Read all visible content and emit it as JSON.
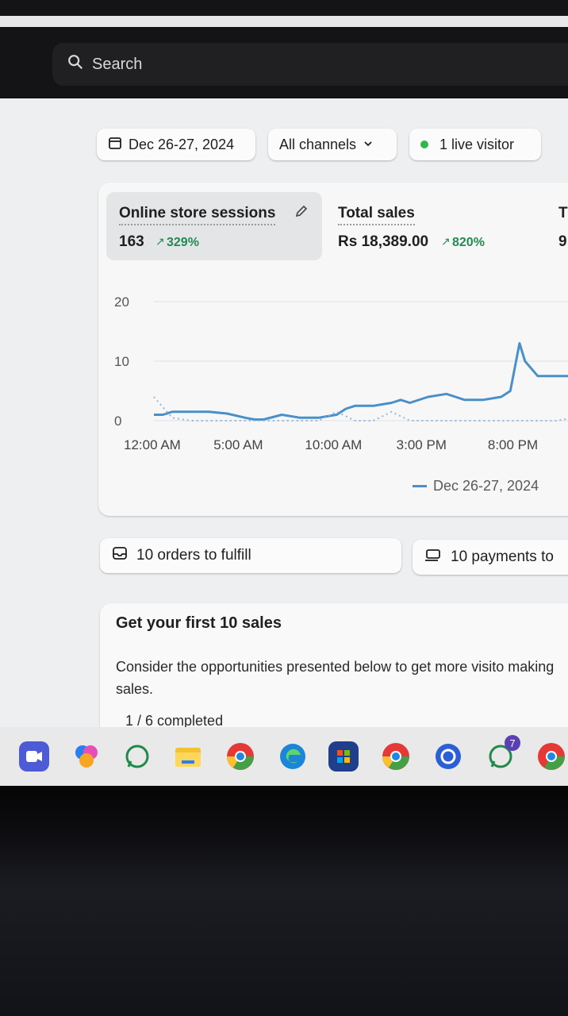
{
  "search": {
    "label": "Search"
  },
  "filters": {
    "date_range": "Dec 26-27, 2024",
    "channels": "All channels",
    "live_visitors": "1 live visitor"
  },
  "metrics": [
    {
      "label": "Online store sessions",
      "value": "163",
      "change": "329%"
    },
    {
      "label": "Total sales",
      "value": "Rs 18,389.00",
      "change": "820%"
    }
  ],
  "metric_partial": {
    "label": "T",
    "value": "9"
  },
  "chart_data": {
    "type": "line",
    "x_ticks": [
      "12:00 AM",
      "5:00 AM",
      "10:00 AM",
      "3:00 PM",
      "8:00 PM"
    ],
    "y_ticks": [
      "20",
      "10",
      "0"
    ],
    "ylim": [
      0,
      20
    ],
    "series": [
      {
        "name": "Dec 26-27, 2024",
        "x": [
          0,
          0.5,
          1,
          2,
          3,
          4,
          5,
          5.5,
          6,
          7,
          8,
          9,
          10,
          10.5,
          11,
          12,
          13,
          13.5,
          14,
          15,
          16,
          16.5,
          17,
          17.5,
          18,
          19,
          19.5,
          20,
          20.3,
          21,
          22,
          23
        ],
        "values": [
          1,
          1,
          1.5,
          1.5,
          1.5,
          1.2,
          0.5,
          0.2,
          0.2,
          1,
          0.5,
          0.5,
          1,
          2,
          2.5,
          2.5,
          3,
          3.5,
          3,
          4,
          4.5,
          4,
          3.5,
          3.5,
          3.5,
          4,
          5,
          13,
          10,
          7.5,
          7.5,
          7.5
        ]
      },
      {
        "name": "comparison",
        "style": "dotted",
        "x": [
          0,
          1,
          2,
          3,
          4,
          5,
          6,
          7,
          8,
          9,
          10,
          11,
          12,
          13,
          14,
          15,
          16,
          17,
          18,
          19,
          20,
          21,
          22,
          23
        ],
        "values": [
          4,
          0.5,
          0,
          0,
          0,
          0,
          0,
          0,
          0,
          0,
          1.5,
          0,
          0,
          1.5,
          0,
          0,
          0,
          0,
          0,
          0,
          0,
          0,
          0,
          0.5
        ]
      }
    ],
    "legend": [
      "Dec 26-27, 2024"
    ],
    "colors": {
      "primary": "#4a90c8",
      "comparison": "#8fb7d9"
    }
  },
  "tasks": {
    "orders": "10 orders to fulfill",
    "payments": "10 payments to"
  },
  "onboarding": {
    "title": "Get your first 10 sales",
    "description": "Consider the opportunities presented below to get more visito making sales.",
    "progress": "1 / 6 completed"
  },
  "taskbar": {
    "icons": [
      "teams-icon",
      "copilot-icon",
      "whatsapp-icon",
      "file-explorer-icon",
      "chrome-icon",
      "edge-icon",
      "microsoft-store-icon",
      "chrome-profile-icon",
      "remote-desktop-icon",
      "whatsapp-badge-icon",
      "chrome-alt-icon"
    ],
    "whatsapp_badge": "7"
  }
}
